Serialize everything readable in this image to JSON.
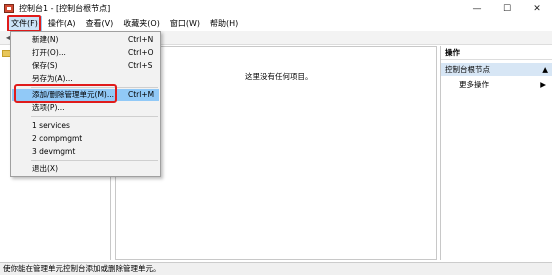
{
  "window": {
    "title": "控制台1 - [控制台根节点]",
    "controls": [
      "—",
      "☐",
      "✕"
    ]
  },
  "menubar": [
    "文件(F)",
    "操作(A)",
    "查看(V)",
    "收藏夹(O)",
    "窗口(W)",
    "帮助(H)"
  ],
  "toolbar": {
    "back": "◀"
  },
  "center": {
    "empty_message": "这里没有任何项目。"
  },
  "actions": {
    "header": "操作",
    "section": "控制台根节点",
    "item": "更多操作",
    "arrow": "▶"
  },
  "file_menu": {
    "items": [
      {
        "label": "新建(N)",
        "accel": "Ctrl+N"
      },
      {
        "label": "打开(O)...",
        "accel": "Ctrl+O"
      },
      {
        "label": "保存(S)",
        "accel": "Ctrl+S"
      },
      {
        "label": "另存为(A)...",
        "accel": ""
      },
      {
        "label": "添加/删除管理单元(M)...",
        "accel": "Ctrl+M"
      },
      {
        "label": "选项(P)...",
        "accel": ""
      },
      {
        "label": "1 services",
        "accel": ""
      },
      {
        "label": "2 compmgmt",
        "accel": ""
      },
      {
        "label": "3 devmgmt",
        "accel": ""
      },
      {
        "label": "退出(X)",
        "accel": ""
      }
    ]
  },
  "status": {
    "text": "使你能在管理单元控制台添加或删除管理单元。"
  },
  "colors": {
    "highlight": "#91c9f7",
    "annotation_red": "#e01b1b",
    "action_section_bg": "#d7e6f5"
  }
}
